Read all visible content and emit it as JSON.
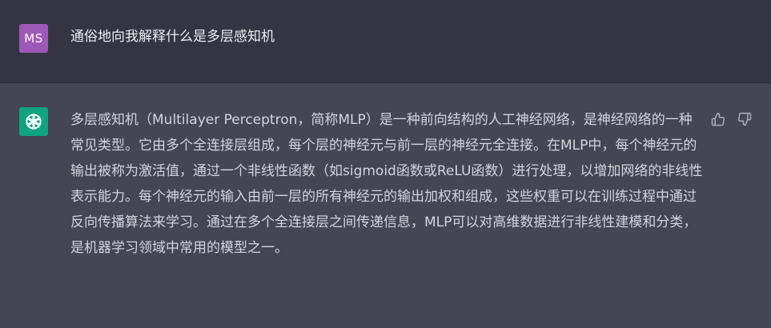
{
  "user": {
    "avatar_initials": "MS",
    "message": "通俗地向我解释什么是多层感知机"
  },
  "assistant": {
    "avatar_icon": "openai-logo-icon",
    "message": "多层感知机（Multilayer Perceptron，简称MLP）是一种前向结构的人工神经网络，是神经网络的一种常见类型。它由多个全连接层组成，每个层的神经元与前一层的神经元全连接。在MLP中，每个神经元的输出被称为激活值，通过一个非线性函数（如sigmoid函数或ReLU函数）进行处理，以增加网络的非线性表示能力。每个神经元的输入由前一层的所有神经元的输出加权和组成，这些权重可以在训练过程中通过反向传播算法来学习。通过在多个全连接层之间传递信息，MLP可以对高维数据进行非线性建模和分类，是机器学习领域中常用的模型之一。",
    "feedback_icons": [
      "thumbs-up-icon",
      "thumbs-down-icon"
    ]
  },
  "colors": {
    "user_bg": "#343541",
    "assistant_bg": "#444654",
    "user_avatar": "#9e59b8",
    "bot_avatar": "#10a37f",
    "text": "#d1d5db"
  }
}
